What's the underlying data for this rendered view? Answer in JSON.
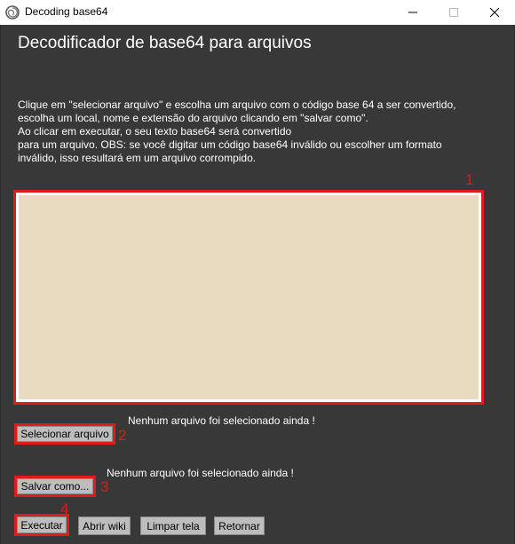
{
  "window": {
    "title": "Decoding base64",
    "app_icon": "swirl-app-icon"
  },
  "heading": "Decodificador de base64 para arquivos",
  "description_lines": [
    "Clique em \"selecionar arquivo\" e escolha um arquivo com o código base 64 a ser convertido,",
    "escolha um local, nome e extensão do arquivo clicando em \"salvar como\".",
    "Ao clicar em executar, o seu texto base64 será convertido",
    "para um arquivo. OBS: se você digitar um código base64 inválido ou escolher um formato",
    "inválido, isso resultará em um arquivo corrompido."
  ],
  "textarea": {
    "value": "",
    "background": "#e9dbbf"
  },
  "markers": [
    "1",
    "2",
    "3",
    "4"
  ],
  "select_file": {
    "button_label": "Selecionar arquivo",
    "status": "Nenhum arquivo foi selecionado ainda !"
  },
  "save_as": {
    "button_label": "Salvar como...",
    "status": "Nenhum arquivo foi selecionado ainda !"
  },
  "actions": {
    "execute": "Executar",
    "open_wiki": "Abrir wiki",
    "clear": "Limpar tela",
    "back": "Retornar"
  },
  "colors": {
    "highlight": "#e11b1b",
    "background": "#383838",
    "button": "#bdbdbd"
  }
}
